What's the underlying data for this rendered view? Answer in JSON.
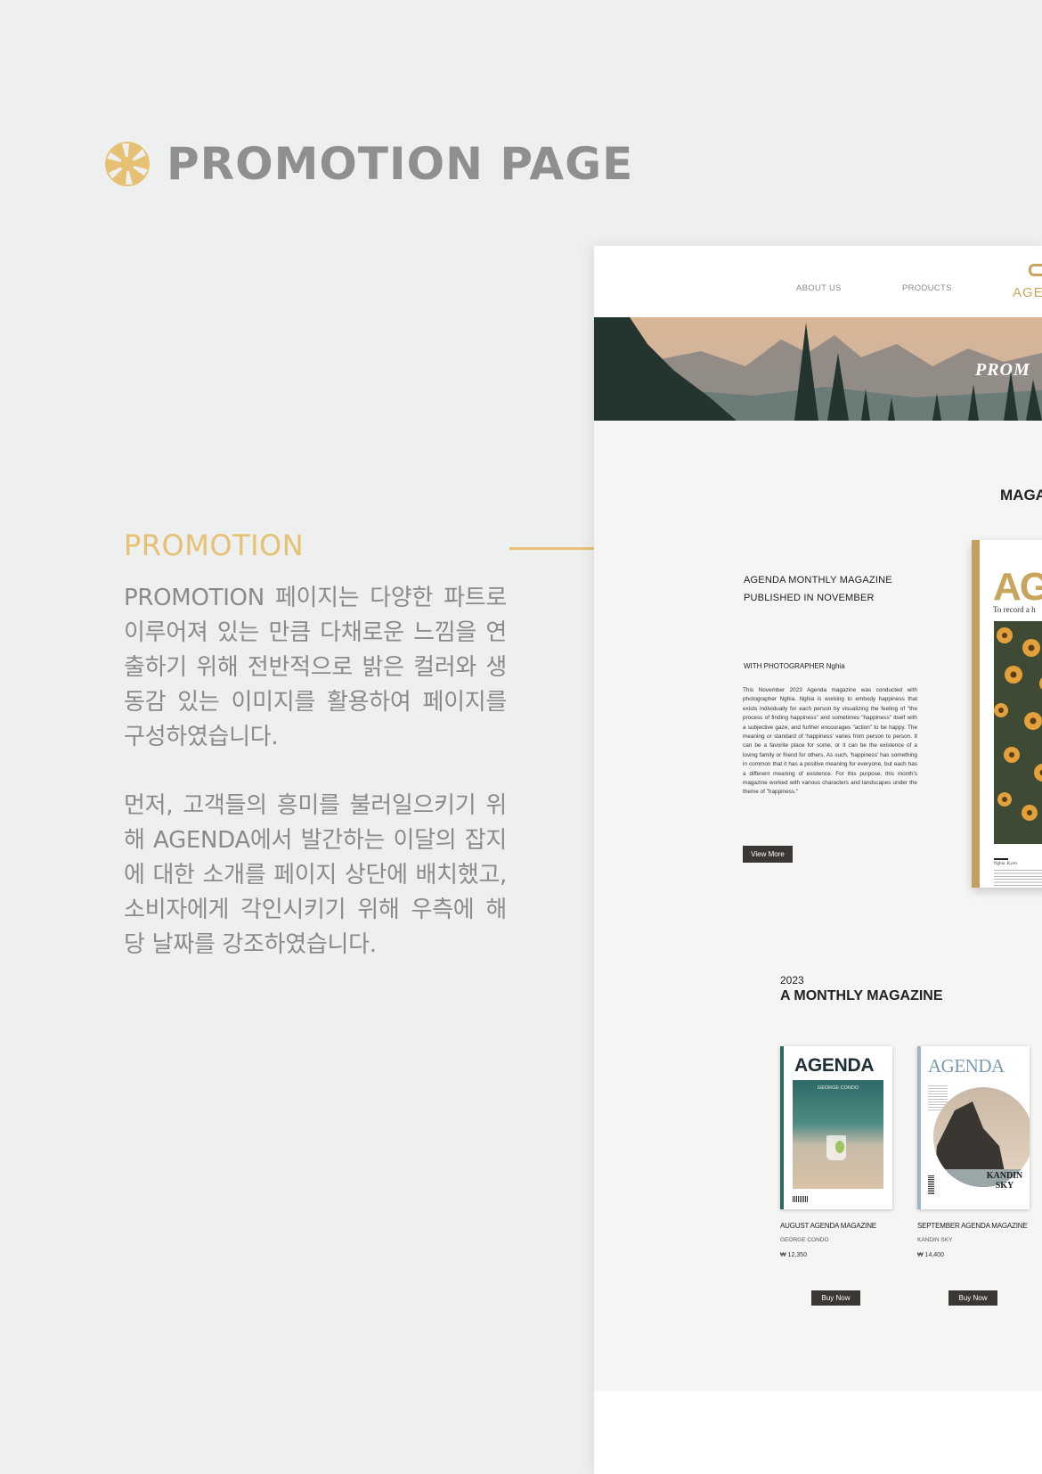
{
  "header": {
    "title": "PROMOTION PAGE",
    "icon": "aperture-icon"
  },
  "accent_color": "#e6c073",
  "promotion": {
    "label": "PROMOTION",
    "paragraph1": "PROMOTION 페이지는 다양한 파트로 이루어져 있는 만큼 다채로운 느낌을 연출하기 위해 전반적으로 밝은 컬러와 생동감 있는 이미지를 활용하여 페이지를 구성하였습니다.",
    "paragraph2": "먼저, 고객들의 흥미를 불러일으키기 위해 AGENDA에서 발간하는 이달의 잡지에 대한 소개를 페이지 상단에 배치했고, 소비자에게 각인시키기 위해 우측에 해당 날짜를 강조하였습니다."
  },
  "screen": {
    "nav": {
      "about": "ABOUT US",
      "products": "PRODUCTS",
      "logo": "AGE"
    },
    "banner_text": "PROM",
    "section_heading": "MAGA",
    "magazine_line1": "AGENDA MONTHLY MAGAZINE",
    "magazine_line2": "PUBLISHED IN NOVEMBER",
    "photographer": "WITH PHOTOGRAPHER Nghia",
    "body": "This November 2023 Agenda magazine was conducted with photographer Nghia. Nghia is working to embody happiness that exists individually for each person by visualizing the feeling of \"the process of finding happiness\" and sometimes \"happiness\" itself with a subjective gaze, and further encourages \"action\" to be happy. The meaning or standard of 'happiness' varies from person to person. It can be a favorite place for some, or it can be the existence of a loving family or friend for others. As such, 'happiness' has something in common that it has a positive meaning for everyone, but each has a different meaning of existence. For this purpose, this month's magazine worked with various characters and landscapes under the theme of \"happiness.\"",
    "view_more": "View More",
    "cover": {
      "title": "AG",
      "tagline": "To record a h",
      "author": "Nghia .Kyon"
    },
    "year": "2023",
    "monthly_heading": "A MONTHLY MAGAZINE",
    "products": [
      {
        "cover_title": "AGENDA",
        "cover_author": "GEORGE CONDO",
        "name": "AUGUST AGENDA MAGAZINE",
        "author": "GEORGE CONDO",
        "price": "₩ 12,350",
        "buy_label": "Buy Now"
      },
      {
        "cover_title": "AGENDA",
        "cover_author": "KANDIN SKY",
        "name": "SEPTEMBER AGENDA MAGAZINE",
        "author": "KANDIN SKY",
        "price": "₩ 14,400",
        "buy_label": "Buy Now"
      }
    ]
  }
}
